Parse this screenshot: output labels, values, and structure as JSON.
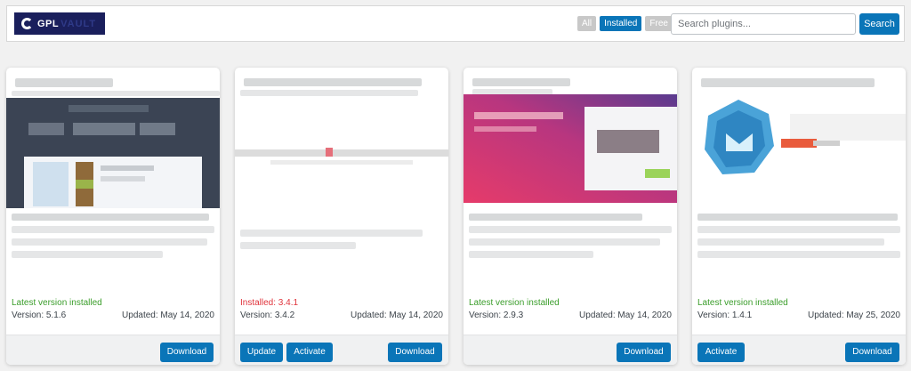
{
  "header": {
    "logo": {
      "text": "GPL",
      "suffix": "VAULT"
    },
    "filters": [
      {
        "label": "All",
        "active": false
      },
      {
        "label": "Installed",
        "active": true
      },
      {
        "label": "Free",
        "active": false
      }
    ],
    "search": {
      "placeholder": "Search plugins...",
      "value": ""
    },
    "search_button": "Search"
  },
  "colors": {
    "accent": "#0a75b8",
    "installed_green": "#3a9d2a",
    "outdated_red": "#e0343c"
  },
  "cards": [
    {
      "status": "Latest version installed",
      "version": "Version: 5.1.6",
      "updated": "Updated: May 14, 2020",
      "buttons": [
        "Download"
      ]
    },
    {
      "status": "Installed: 3.4.1",
      "version": "Version: 3.4.2",
      "updated": "Updated: May 14, 2020",
      "buttons": [
        "Update",
        "Activate",
        "Download"
      ]
    },
    {
      "status": "Latest version installed",
      "version": "Version: 2.9.3",
      "updated": "Updated: May 14, 2020",
      "buttons": [
        "Download"
      ]
    },
    {
      "status": "Latest version installed",
      "version": "Version: 1.4.1",
      "updated": "Updated: May 25, 2020",
      "buttons": [
        "Activate",
        "Download"
      ]
    }
  ]
}
